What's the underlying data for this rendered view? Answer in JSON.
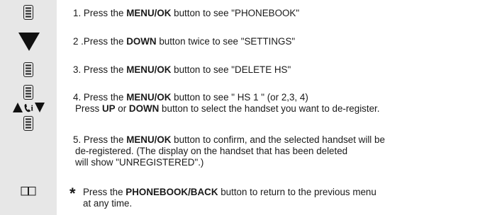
{
  "icons": {
    "step1": "menu-ok-key-icon",
    "step2": "down-arrow-icon",
    "step3": "menu-ok-key-icon",
    "step4a": "menu-ok-key-icon",
    "step4b": "up-phone-down-icon",
    "step5": "menu-ok-key-icon",
    "note": "open-book-icon"
  },
  "steps": [
    {
      "lines": [
        [
          "1. Press the ",
          "MENU/OK",
          " button to see \"PHONEBOOK\""
        ]
      ]
    },
    {
      "lines": [
        [
          "2 .Press the ",
          "DOWN",
          " button twice to see \"SETTINGS\""
        ]
      ]
    },
    {
      "lines": [
        [
          "3. Press the ",
          "MENU/OK",
          " button to see  \"DELETE  HS\""
        ]
      ]
    },
    {
      "lines": [
        [
          "4. Press the ",
          "MENU/OK",
          " button to see  \" HS 1 \"  (or 2,3, 4)"
        ],
        [
          "Press ",
          "UP",
          " or ",
          "DOWN",
          " button to select the handset you want to de-register."
        ]
      ]
    },
    {
      "lines": [
        [
          "5. Press the ",
          "MENU/OK",
          " button to confirm, and the selected handset will be"
        ],
        [
          "de-registered. (The display on the handset that has been deleted"
        ],
        [
          "will show \"UNREGISTERED\".)"
        ]
      ]
    }
  ],
  "note": {
    "star": "*",
    "lines": [
      [
        "Press the ",
        "PHONEBOOK/BACK",
        " button to return to the previous menu"
      ],
      [
        "at any time."
      ]
    ]
  }
}
